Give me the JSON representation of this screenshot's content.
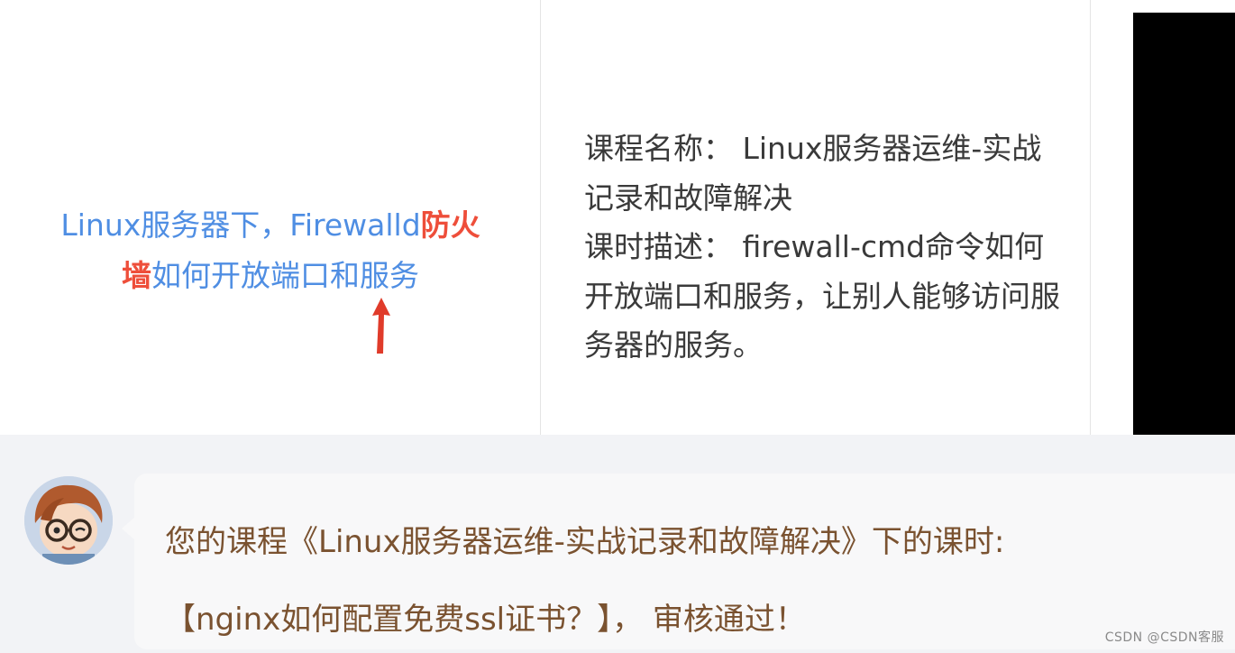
{
  "course_card": {
    "title_part1": "Linux服务器下，Firewalld",
    "title_highlight1": "防火",
    "title_highlight2": "墙",
    "title_part2": "如何开放端口和服务",
    "course_name_label": "课程名称：",
    "course_name_value": "Linux服务器运维-实战记录和故障解决",
    "lesson_desc_label": "课时描述：",
    "lesson_desc_value": "firewall-cmd命令如何开放端口和服务，让别人能够访问服务器的服务。"
  },
  "message": {
    "line1": "您的课程《Linux服务器运维-实战记录和故障解决》下的课时:",
    "line2": "【nginx如何配置免费ssl证书？】， 审核通过！"
  },
  "watermark": "CSDN @CSDN客服",
  "colors": {
    "title_blue": "#4f8ee3",
    "highlight_red": "#ee4e3a",
    "message_brown": "#7a5230",
    "bubble_bg": "#f8f8f9",
    "arrow_red": "#e03b2a"
  },
  "icons": {
    "arrow": "red-up-arrow",
    "avatar": "cartoon-avatar-with-glasses"
  }
}
